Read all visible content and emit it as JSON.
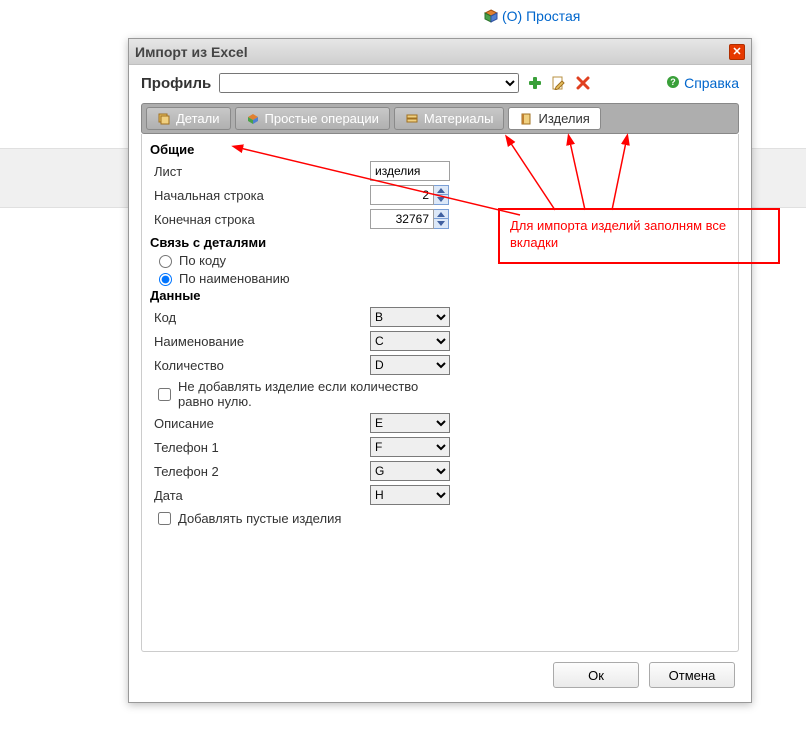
{
  "top_link": {
    "label": "(О) Простая"
  },
  "dialog": {
    "title": "Импорт из Excel",
    "profile_label": "Профиль",
    "profile_value": "",
    "help_label": "Справка"
  },
  "tabs": {
    "details": "Детали",
    "operations": "Простые операции",
    "materials": "Материалы",
    "products": "Изделия"
  },
  "sections": {
    "common": "Общие",
    "link": "Связь с деталями",
    "data": "Данные"
  },
  "fields": {
    "sheet_label": "Лист",
    "sheet_value": "изделия",
    "start_row_label": "Начальная строка",
    "start_row_value": "2",
    "end_row_label": "Конечная строка",
    "end_row_value": "32767",
    "by_code": "По коду",
    "by_name": "По наименованию",
    "code_label": "Код",
    "code_value": "B",
    "name_label": "Наименование",
    "name_value": "C",
    "qty_label": "Количество",
    "qty_value": "D",
    "skip_zero_label": "Не добавлять изделие если количество равно нулю.",
    "desc_label": "Описание",
    "desc_value": "E",
    "phone1_label": "Телефон 1",
    "phone1_value": "F",
    "phone2_label": "Телефон 2",
    "phone2_value": "G",
    "date_label": "Дата",
    "date_value": "H",
    "add_empty_label": "Добавлять пустые изделия"
  },
  "buttons": {
    "ok": "Ок",
    "cancel": "Отмена"
  },
  "annotation": {
    "text": "Для импорта изделий заполням все вкладки"
  }
}
